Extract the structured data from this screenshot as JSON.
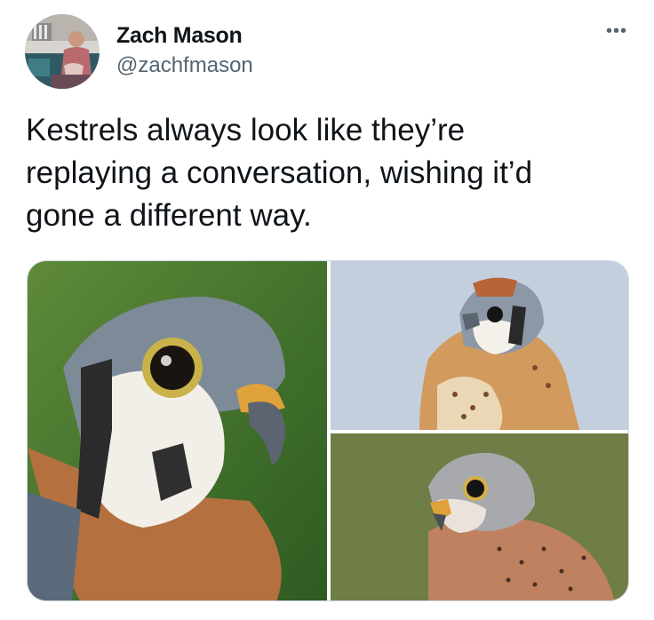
{
  "tweet": {
    "author": {
      "display_name": "Zach Mason",
      "handle": "@zachfmason"
    },
    "more_icon": "more-horizontal-icon",
    "text_lines": [
      "Kestrels always look like they’re",
      "replaying a conversation, wishing it’d",
      "gone a different way."
    ],
    "media": {
      "count": 3
    }
  },
  "colors": {
    "text": "#0f1419",
    "secondary": "#536471",
    "border": "#cfd9de"
  }
}
